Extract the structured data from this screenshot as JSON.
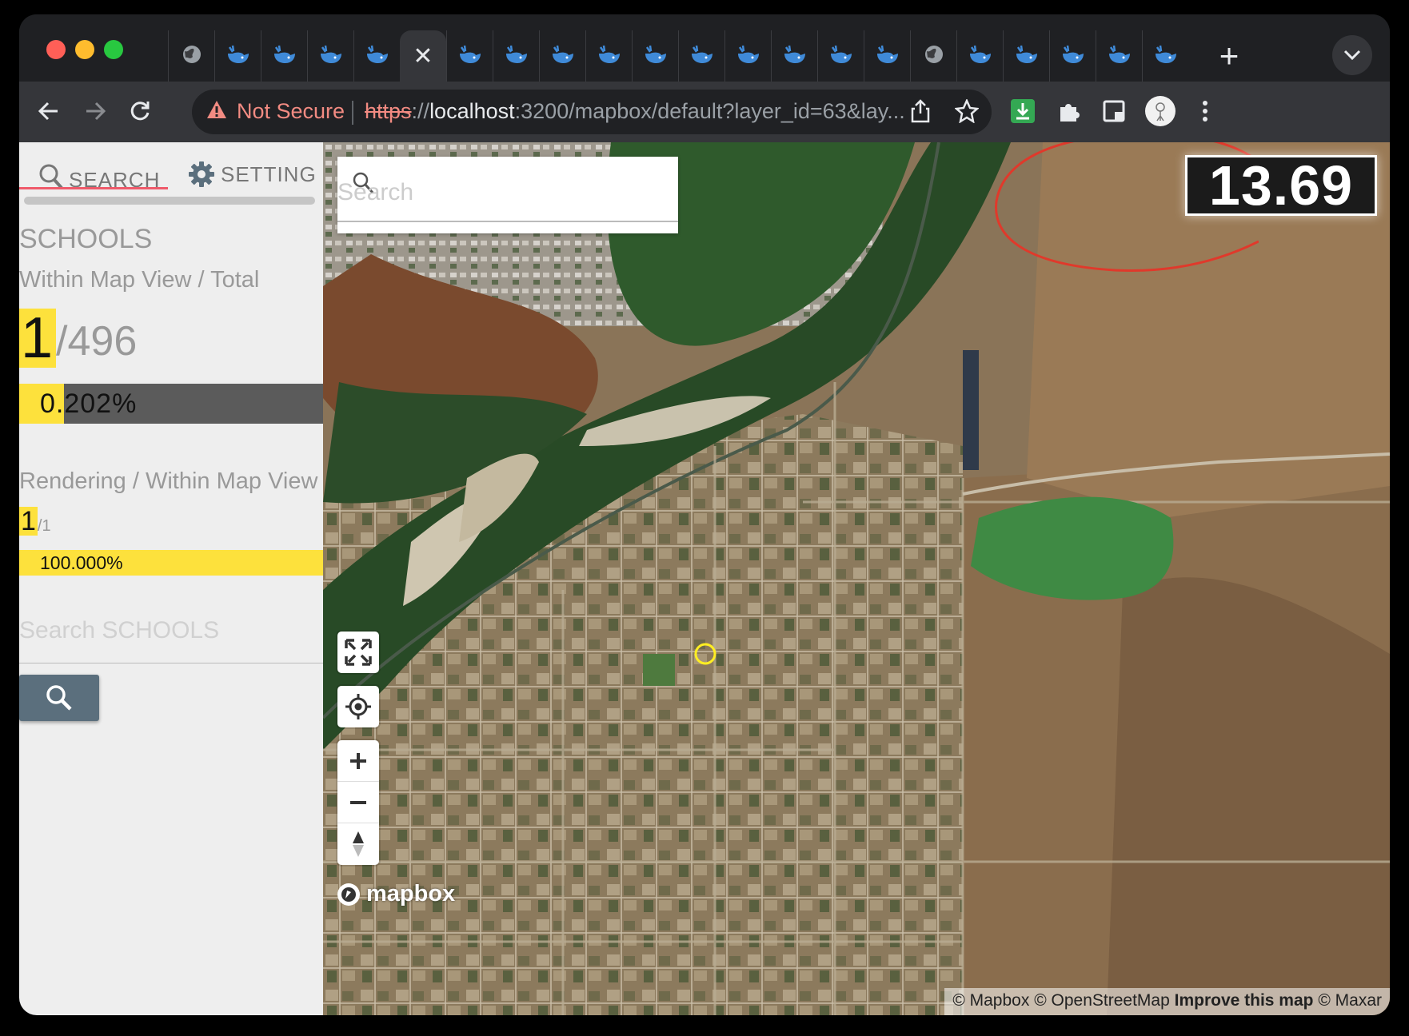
{
  "browser": {
    "colors": {
      "close": "#ff5f57",
      "minimize": "#febc2e",
      "maximize": "#28c840"
    },
    "tabs": [
      {
        "icon": "globe-icon"
      },
      {
        "icon": "whale-icon"
      },
      {
        "icon": "whale-icon"
      },
      {
        "icon": "whale-icon"
      },
      {
        "icon": "whale-icon"
      },
      {
        "icon": "close-icon",
        "active": true
      },
      {
        "icon": "whale-icon"
      },
      {
        "icon": "whale-icon"
      },
      {
        "icon": "whale-icon"
      },
      {
        "icon": "whale-icon"
      },
      {
        "icon": "whale-icon"
      },
      {
        "icon": "whale-icon"
      },
      {
        "icon": "whale-icon"
      },
      {
        "icon": "whale-icon"
      },
      {
        "icon": "whale-icon"
      },
      {
        "icon": "whale-icon"
      },
      {
        "icon": "globe-icon"
      },
      {
        "icon": "whale-icon"
      },
      {
        "icon": "whale-icon"
      },
      {
        "icon": "whale-icon"
      },
      {
        "icon": "whale-icon"
      },
      {
        "icon": "whale-icon"
      }
    ],
    "new_tab_label": "+",
    "security_label": "Not Secure",
    "url_scheme": "https",
    "url_sep": "://",
    "url_host": "localhost",
    "url_rest": ":3200/mapbox/default?layer_id=63&lay..."
  },
  "sidebar": {
    "tab_search": "SEARCH",
    "tab_setting": "SETTING",
    "layer_title": "SCHOOLS",
    "within_label": "Within Map View / Total",
    "within_count": "1",
    "total_count": "/496",
    "within_percent_text": "0.202%",
    "within_fraction": 0.00202,
    "rendering_label": "Rendering / Within Map View",
    "rendering_count": "1",
    "rendering_total": "/1",
    "rendering_percent_text": "100.000%",
    "rendering_fraction": 1.0,
    "search_placeholder": "Search SCHOOLS"
  },
  "map": {
    "search_placeholder": "Search",
    "zoom_level": "13.69",
    "logo_text": "mapbox",
    "attribution": {
      "mapbox": "© Mapbox",
      "osm": "© OpenStreetMap",
      "improve": "Improve this map",
      "maxar": "© Maxar"
    },
    "annotation_color": "#e0392b",
    "marker_color": "#ffee22"
  }
}
